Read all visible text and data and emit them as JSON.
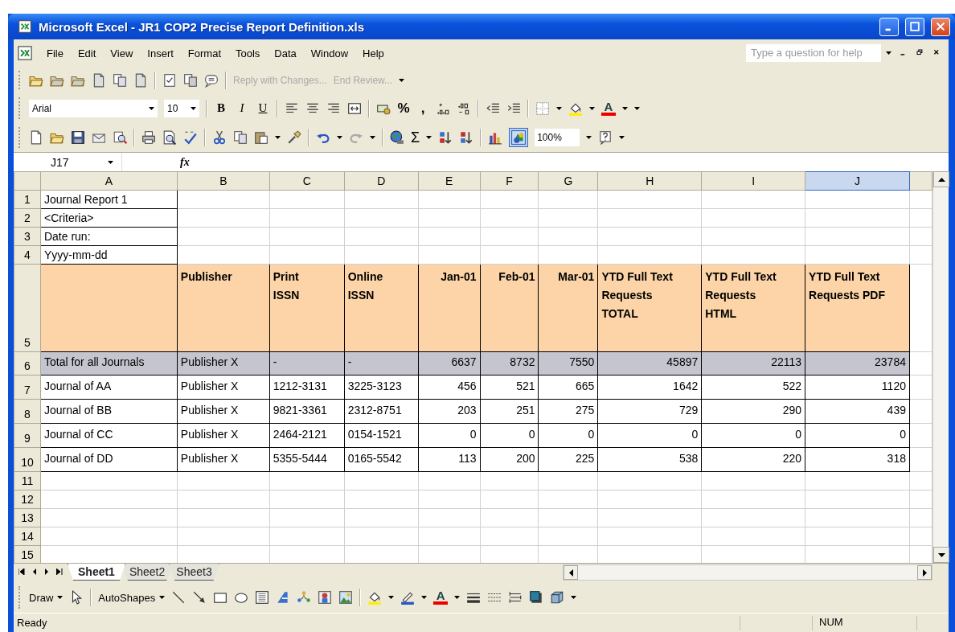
{
  "window": {
    "title": "Microsoft Excel - JR1 COP2 Precise Report Definition.xls"
  },
  "menu": [
    "File",
    "Edit",
    "View",
    "Insert",
    "Format",
    "Tools",
    "Data",
    "Window",
    "Help"
  ],
  "help_search": {
    "placeholder": "Type a question for help"
  },
  "review_toolbar": {
    "items": [
      {
        "label": "Reply with Changes...",
        "disabled": true
      },
      {
        "label": "End Review...",
        "disabled": true
      }
    ]
  },
  "formatting_toolbar": {
    "font": "Arial",
    "size": "10",
    "style_buttons": [
      "B",
      "I",
      "U"
    ],
    "number_buttons": [
      "%",
      ","
    ],
    "font_color": "A"
  },
  "standard_toolbar": {
    "autosum": "Σ",
    "zoom": "100%"
  },
  "formula_bar": {
    "name_box": "J17",
    "function_label": "fx"
  },
  "columns": [
    {
      "label": "A",
      "selected": false
    },
    {
      "label": "B",
      "selected": false
    },
    {
      "label": "C",
      "selected": false
    },
    {
      "label": "D",
      "selected": false
    },
    {
      "label": "E",
      "selected": false
    },
    {
      "label": "F",
      "selected": false
    },
    {
      "label": "G",
      "selected": false
    },
    {
      "label": "H",
      "selected": false
    },
    {
      "label": "I",
      "selected": false
    },
    {
      "label": "J",
      "selected": true
    }
  ],
  "rows": [
    {
      "number": "1",
      "kind": "title",
      "cells": [
        "Journal Report 1"
      ]
    },
    {
      "number": "2",
      "kind": "title",
      "cells": [
        "<Criteria>"
      ]
    },
    {
      "number": "3",
      "kind": "title",
      "cells": [
        "Date run:"
      ]
    },
    {
      "number": "4",
      "kind": "title",
      "cells": [
        "Yyyy-mm-dd"
      ]
    },
    {
      "number": "5",
      "kind": "header",
      "cells": [
        "Publisher",
        "Print\nISSN",
        "Online\nISSN",
        "Jan-01",
        "Feb-01",
        "Mar-01",
        "YTD Full Text\nRequests\nTOTAL",
        "YTD Full Text\nRequests\nHTML",
        "YTD Full Text\nRequests PDF"
      ]
    },
    {
      "number": "6",
      "kind": "total",
      "cells": [
        "Total for all Journals",
        "Publisher X",
        "-",
        "-",
        "6637",
        "8732",
        "7550",
        "45897",
        "22113",
        "23784"
      ]
    },
    {
      "number": "7",
      "kind": "data",
      "cells": [
        "Journal of AA",
        "Publisher X",
        "1212-3131",
        "3225-3123",
        "456",
        "521",
        "665",
        "1642",
        "522",
        "1120"
      ]
    },
    {
      "number": "8",
      "kind": "data",
      "cells": [
        "Journal of BB",
        "Publisher X",
        "9821-3361",
        "2312-8751",
        "203",
        "251",
        "275",
        "729",
        "290",
        "439"
      ]
    },
    {
      "number": "9",
      "kind": "data",
      "cells": [
        "Journal of CC",
        "Publisher X",
        "2464-2121",
        "0154-1521",
        "0",
        "0",
        "0",
        "0",
        "0",
        "0"
      ]
    },
    {
      "number": "10",
      "kind": "data",
      "cells": [
        "Journal of DD",
        "Publisher X",
        "5355-5444",
        "0165-5542",
        "113",
        "200",
        "225",
        "538",
        "220",
        "318"
      ]
    },
    {
      "number": "11",
      "kind": "empty"
    },
    {
      "number": "12",
      "kind": "empty"
    },
    {
      "number": "13",
      "kind": "empty"
    },
    {
      "number": "14",
      "kind": "empty"
    },
    {
      "number": "15",
      "kind": "empty"
    }
  ],
  "sheet_tabs": [
    {
      "label": "Sheet1",
      "selected": true
    },
    {
      "label": "Sheet2",
      "selected": false
    },
    {
      "label": "Sheet3",
      "selected": false
    }
  ],
  "drawing_toolbar": {
    "draw": "Draw",
    "autoshapes": "AutoShapes",
    "font_color": "A"
  },
  "status_bar": {
    "status": "Ready",
    "indicator": "NUM"
  }
}
